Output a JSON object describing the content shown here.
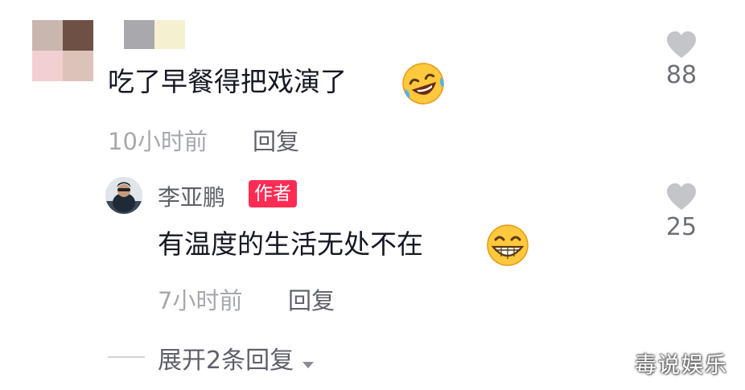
{
  "comment": {
    "text": "吃了早餐得把戏演了",
    "time": "10小时前",
    "reply_label": "回复",
    "like_count": "88",
    "emoji": "laughing-crying-emoji"
  },
  "author_reply": {
    "username": "李亚鹏",
    "badge": "作者",
    "text": "有温度的生活无处不在",
    "time": "7小时前",
    "reply_label": "回复",
    "like_count": "25",
    "emoji": "grinning-emoji"
  },
  "expand_replies": {
    "label": "展开2条回复",
    "icon": "caret-down-icon"
  },
  "watermark": {
    "text": "毒说娱乐"
  },
  "colors": {
    "badge_bg": "#fe2c55",
    "muted_text": "#a6a8ae",
    "secondary_text": "#5e6069",
    "heart": "#c4c5c8"
  }
}
